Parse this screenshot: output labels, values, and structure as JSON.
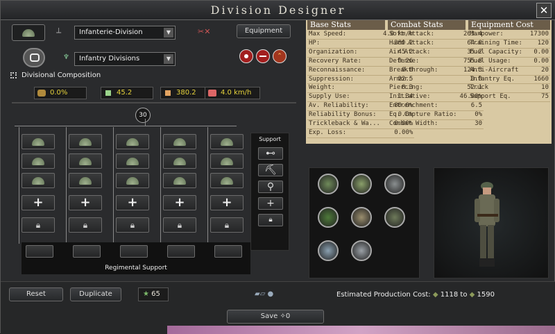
{
  "window": {
    "title": "Division Designer"
  },
  "template": {
    "name": "Infanterie-Division",
    "role": "Infantry Divisions",
    "equipment_label": "Equipment"
  },
  "composition": {
    "header": "Divisional Composition",
    "chips": [
      {
        "name": "entrenchment",
        "value": "0.0%"
      },
      {
        "name": "soft-attack",
        "value": "45.2"
      },
      {
        "name": "hp",
        "value": "380.2"
      },
      {
        "name": "speed",
        "value": "4.0 km/h"
      }
    ],
    "width_badge": "30",
    "support_label": "Support",
    "regimental_label": "Regimental Support"
  },
  "stats": {
    "headers": [
      "Base Stats",
      "Combat Stats",
      "Equipment Cost"
    ],
    "base": [
      [
        "Max Speed:",
        "4.0 km/h"
      ],
      [
        "HP:",
        "380.2"
      ],
      [
        "Organization:",
        "45.2"
      ],
      [
        "Recovery Rate:",
        "0.26"
      ],
      [
        "Reconnaissance:",
        "0.0"
      ],
      [
        "Suppression:",
        "22.5"
      ],
      [
        "Weight:",
        "8.3"
      ],
      [
        "Supply Use:",
        "1.34"
      ],
      [
        "Av. Reliability:",
        "80.0%"
      ],
      [
        "Reliability Bonus:",
        "0.0%"
      ],
      [
        "Trickleback & Wa...",
        "0.00%"
      ],
      [
        "Exp. Loss:",
        "0.00%"
      ]
    ],
    "combat": [
      [
        "Soft Attack:",
        "263.4"
      ],
      [
        "Hard Attack:",
        "64.0"
      ],
      [
        "Air Attack:",
        "35.2"
      ],
      [
        "Defense:",
        "755.8"
      ],
      [
        "Breakthrough:",
        "124.3"
      ],
      [
        "Armor:",
        "0.0"
      ],
      [
        "Piercing:",
        "52.1"
      ],
      [
        "Initiative:",
        "46.00%"
      ],
      [
        "Entrenchment:",
        "6.5"
      ],
      [
        "Eq. Capture Ratio:",
        "0%"
      ],
      [
        "Combat Width:",
        "30"
      ]
    ],
    "equipment": [
      [
        "Manpower:",
        "17300"
      ],
      [
        "Training Time:",
        "120"
      ],
      [
        "Fuel Capacity:",
        "0.00"
      ],
      [
        "Fuel Usage:",
        "0.00"
      ],
      [
        "Anti-Aircraft",
        "20"
      ],
      [
        "Infantry Eq.",
        "1660"
      ],
      [
        "Truck",
        "10"
      ],
      [
        "Support Eq.",
        "75"
      ]
    ]
  },
  "bottom": {
    "reset": "Reset",
    "duplicate": "Duplicate",
    "xp": "65",
    "cost_label": "Estimated Production Cost:",
    "cost_min": "1118",
    "cost_to": "to",
    "cost_max": "1590",
    "save": "Save",
    "save_cost": "0"
  }
}
